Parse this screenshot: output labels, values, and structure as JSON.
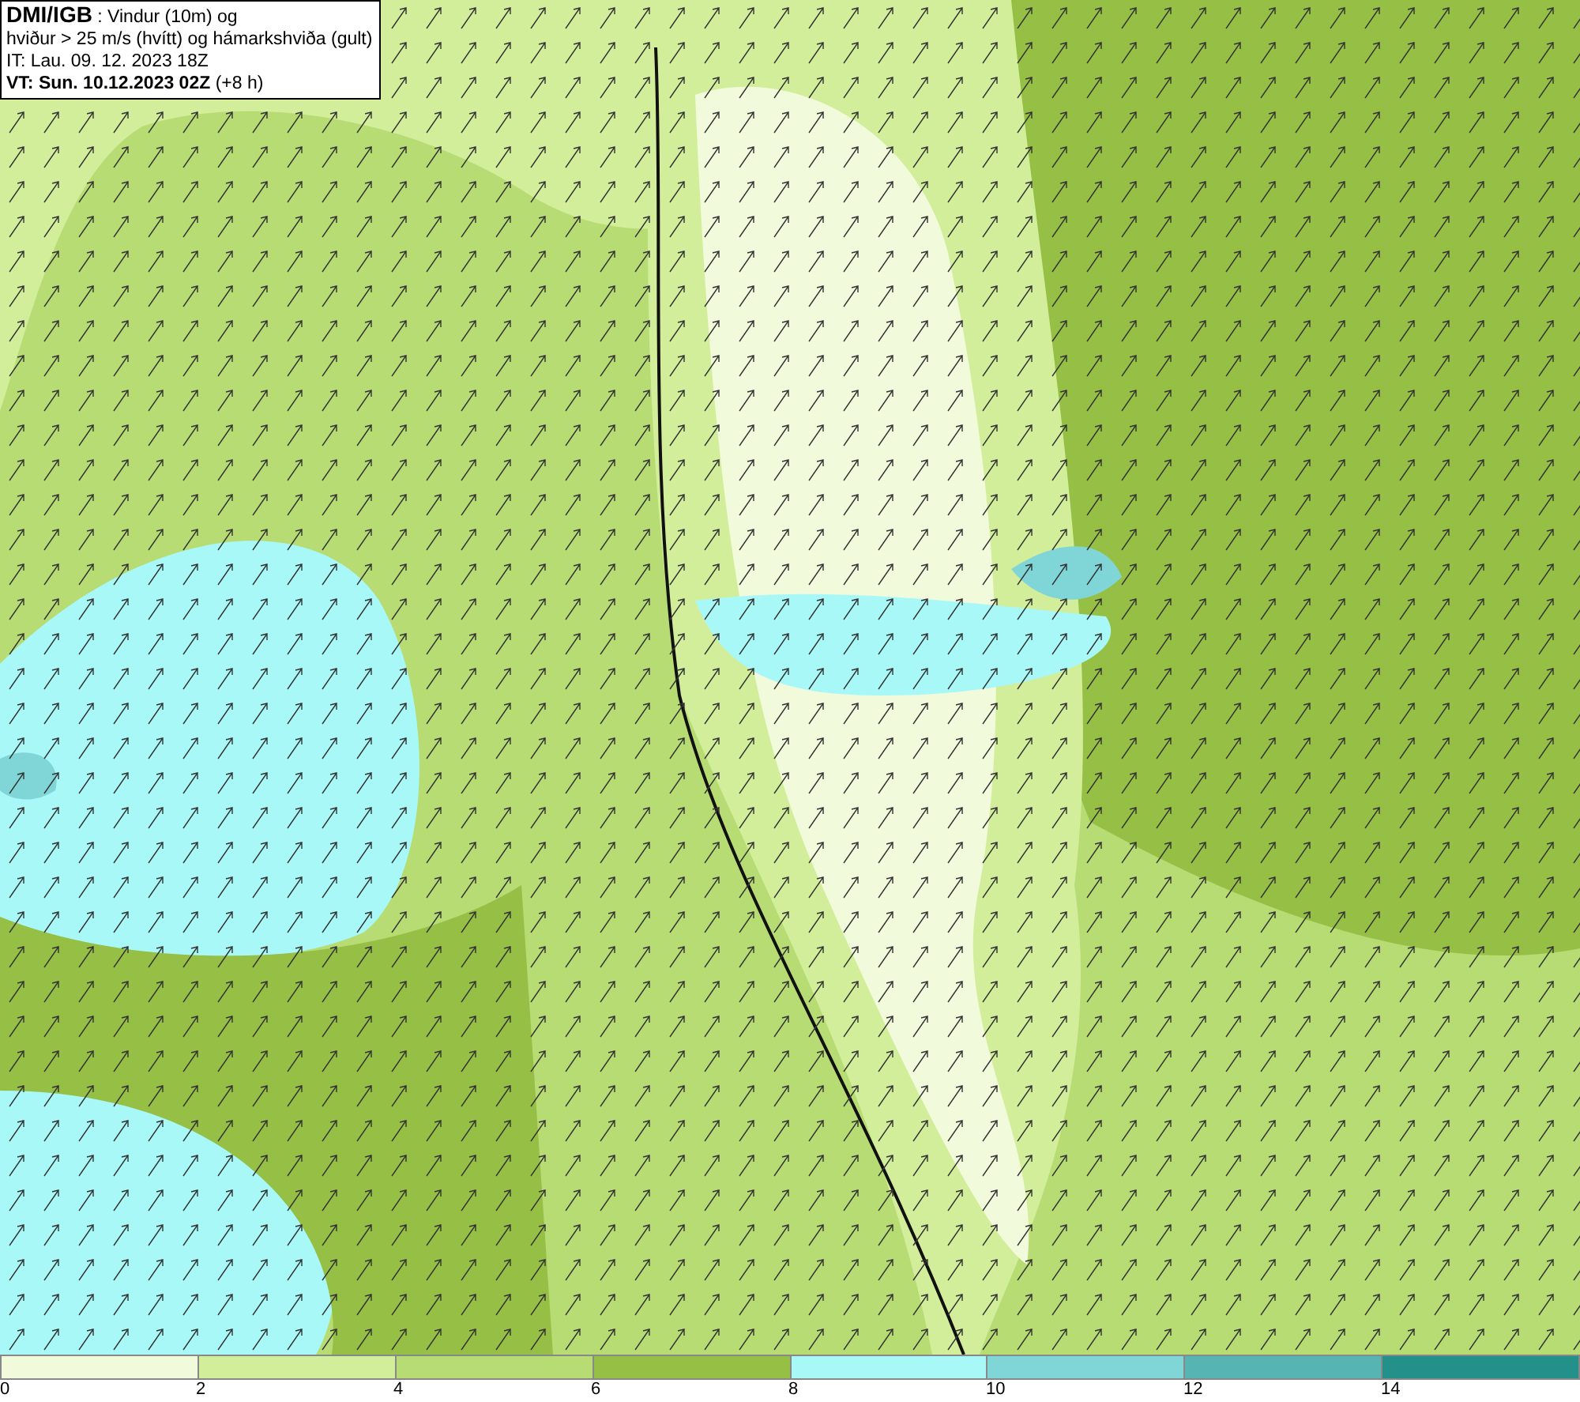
{
  "title_box": {
    "lines": [
      "**DMI/IGB** : Vindur (10m) og",
      "hviður > 25 m/s (hvítt) og hámarkshviða (gult)",
      "IT: Lau. 09. 12. 2023 18Z",
      "**VT: Sun. 10.12.2023 02Z** (+8 h)"
    ]
  },
  "legend": {
    "segments": [
      {
        "color": "#f2fadc"
      },
      {
        "color": "#d3ee9a"
      },
      {
        "color": "#b7dc74"
      },
      {
        "color": "#96bf45"
      },
      {
        "color": "#a8f8f8"
      },
      {
        "color": "#80d6d6"
      },
      {
        "color": "#56b4b2"
      },
      {
        "color": "#24908a"
      }
    ],
    "ticks": [
      "0",
      "2",
      "4",
      "6",
      "8",
      "10",
      "12",
      "14"
    ]
  }
}
